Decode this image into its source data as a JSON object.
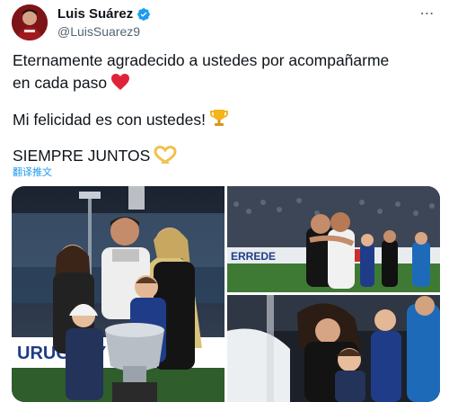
{
  "author": {
    "display_name": "Luis Suárez",
    "handle": "@LuisSuarez9",
    "verified": true
  },
  "more_button": "⋯",
  "tweet": {
    "line_1": "Eternamente agradecido a ustedes por acompañarme",
    "line_2": "en cada paso",
    "line_3": "Mi felicidad es con ustedes!",
    "line_4": "SIEMPRE JUNTOS",
    "emojis": [
      "red-heart",
      "trophy",
      "heart-hands"
    ]
  },
  "translate_label": "翻译推文",
  "media": {
    "photo_count": 3,
    "photo_left_banner_text": "URUGUAY",
    "photo_right_top_banner_text": "ERREDE"
  },
  "colors": {
    "link": "#1d9bf0",
    "verified": "#1d9bf0",
    "secondary_text": "#536471",
    "primary_text": "#0f1419"
  }
}
